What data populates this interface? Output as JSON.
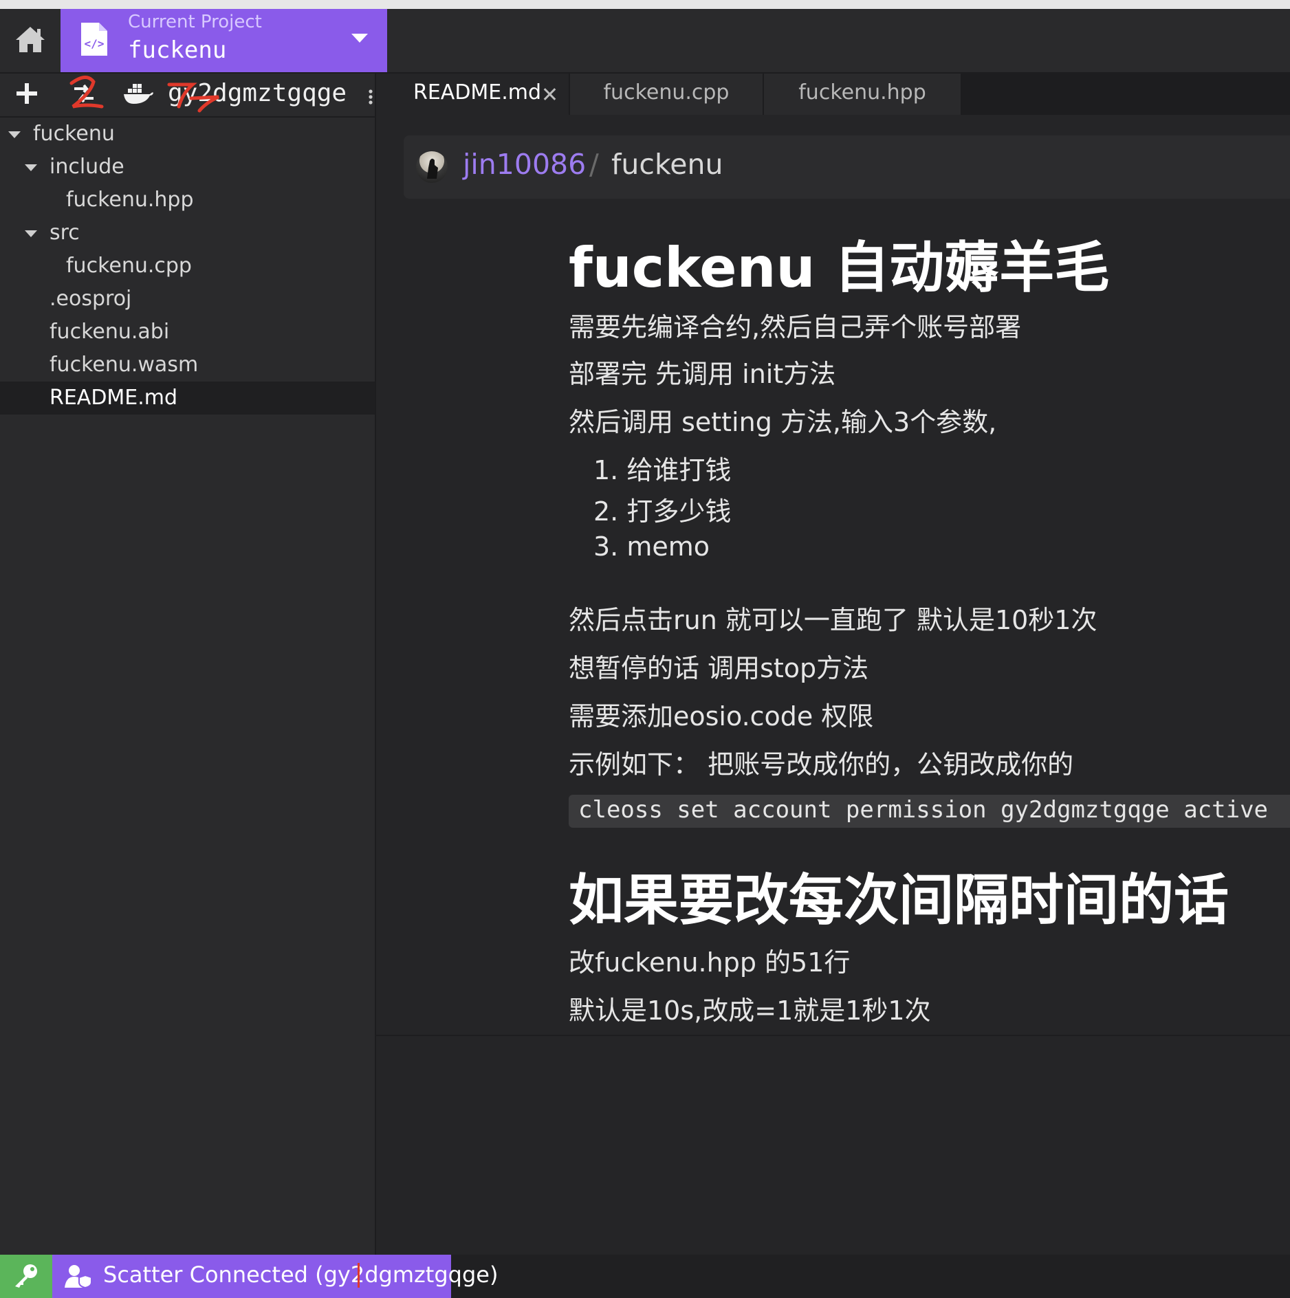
{
  "topbar": {
    "project_label": "Current Project",
    "project_name": "fuckenu",
    "icons": [
      "home-icon",
      "code-file-icon",
      "caret-down-icon"
    ]
  },
  "sidebar": {
    "toolbar": {
      "account": "gy2dgmztgqge",
      "icons": [
        "plus-icon",
        "deploy-icon",
        "docker-icon",
        "more-icon"
      ]
    },
    "tree": [
      {
        "label": "fuckenu",
        "type": "folder",
        "expanded": true
      },
      {
        "label": "include",
        "type": "folder",
        "expanded": true
      },
      {
        "label": "fuckenu.hpp",
        "type": "file"
      },
      {
        "label": "src",
        "type": "folder",
        "expanded": true
      },
      {
        "label": "fuckenu.cpp",
        "type": "file"
      },
      {
        "label": ".eosproj",
        "type": "file"
      },
      {
        "label": "fuckenu.abi",
        "type": "file"
      },
      {
        "label": "fuckenu.wasm",
        "type": "file"
      },
      {
        "label": "README.md",
        "type": "file",
        "selected": true
      }
    ]
  },
  "tabs": [
    {
      "label": "README.md",
      "active": true
    },
    {
      "label": "fuckenu.cpp",
      "active": false
    },
    {
      "label": "fuckenu.hpp",
      "active": false
    }
  ],
  "readme": {
    "owner": "jin10086",
    "separator": "/",
    "repo": "fuckenu",
    "title": "fuckenu 自动薅羊毛",
    "p1": "需要先编译合约,然后自己弄个账号部署",
    "p2": "部署完 先调用 init方法",
    "p3": "然后调用 setting 方法,输入3个参数,",
    "list": [
      "给谁打钱",
      "打多少钱",
      "memo"
    ],
    "p4": "然后点击run 就可以一直跑了 默认是10秒1次",
    "p5": "想暂停的话 调用stop方法",
    "p6": "需要添加eosio.code 权限",
    "p7": "示例如下：  把账号改成你的，公钥改成你的",
    "code": "cleoss set account permission gy2dgmztgqge active",
    "h2": "如果要改每次间隔时间的话",
    "p8": "改fuckenu.hpp 的51行",
    "p9": "默认是10s,改成=1就是1秒1次"
  },
  "statusbar": {
    "scatter": "Scatter Connected (gy2dgmztgqge)",
    "icons": [
      "key-icon",
      "user-shield-icon"
    ],
    "colors": {
      "key_bg": "#5bb55a",
      "scatter_bg": "#8a5bea"
    }
  },
  "colors": {
    "accent": "#8a5bea",
    "link": "#9d7cf0"
  }
}
